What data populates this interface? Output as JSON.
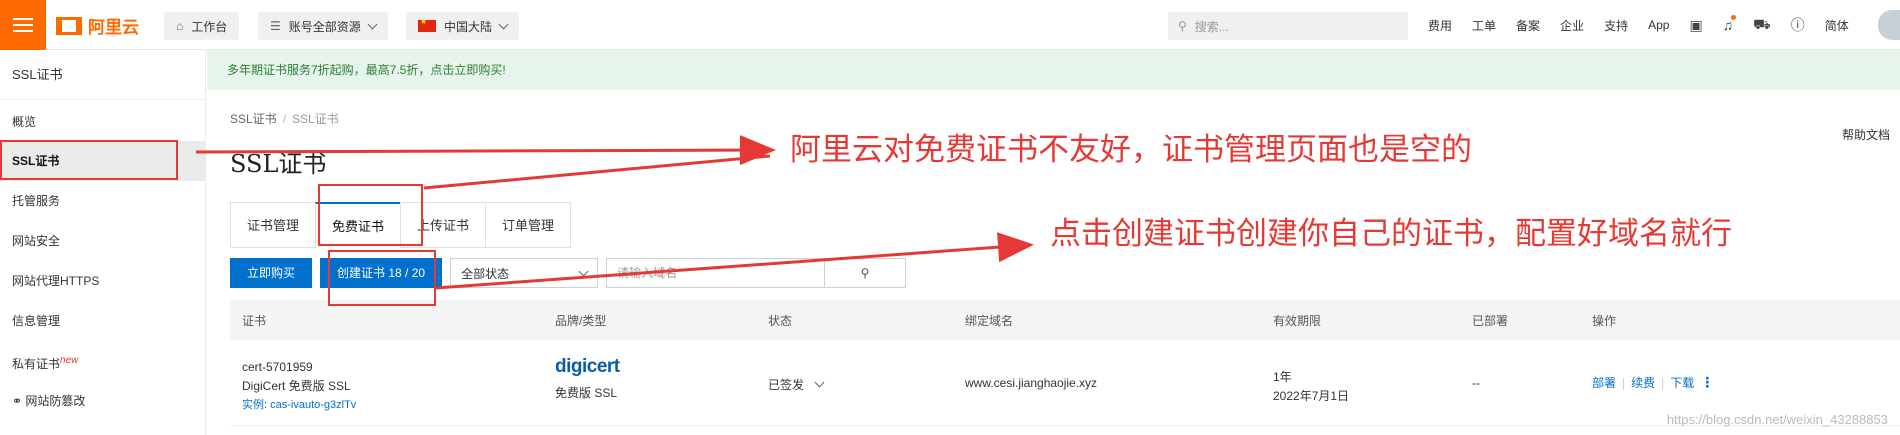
{
  "topbar": {
    "logo_text": "阿里云",
    "workbench": "工作台",
    "resources": "账号全部资源",
    "region": "中国大陆",
    "search_placeholder": "搜索...",
    "links": [
      "费用",
      "工单",
      "备案",
      "企业",
      "支持",
      "App"
    ],
    "lang": "简体",
    "accent_color": "#ff6a00"
  },
  "sidebar": {
    "title": "SSL证书",
    "items": [
      {
        "label": "概览"
      },
      {
        "label": "SSL证书"
      },
      {
        "label": "托管服务"
      },
      {
        "label": "网站安全"
      },
      {
        "label": "网站代理HTTPS"
      },
      {
        "label": "信息管理"
      },
      {
        "label": "私有证书",
        "badge": "new"
      },
      {
        "label": "网站防篡改"
      }
    ]
  },
  "banner": "多年期证书服务7折起购，最高7.5折，点击立即购买!",
  "breadcrumb": [
    "SSL证书",
    "SSL证书"
  ],
  "page_title": "SSL证书",
  "help_link": "帮助文档",
  "tabs": [
    "证书管理",
    "免费证书",
    "上传证书",
    "订单管理"
  ],
  "toolbar": {
    "buy": "立即购买",
    "create": "创建证书 18 / 20",
    "status_select": "全部状态",
    "domain_placeholder": "请输入域名"
  },
  "table": {
    "headers": [
      "证书",
      "品牌/类型",
      "状态",
      "绑定域名",
      "有效期限",
      "已部署",
      "操作"
    ],
    "rows": [
      {
        "cert_id": "cert-5701959",
        "cert_name": "DigiCert 免费版 SSL",
        "instance": "实例: cas-ivauto-g3zlTv",
        "brand_logo": "digicert",
        "brand_type": "免费版 SSL",
        "status": "已签发",
        "domain": "www.cesi.jianghaojie.xyz",
        "validity": "1年",
        "expire": "2022年7月1日",
        "deployed": "--",
        "actions": [
          "部署",
          "续费",
          "下载"
        ]
      }
    ]
  },
  "annotations": {
    "note1": "阿里云对免费证书不友好，证书管理页面也是空的",
    "note2": "点击创建证书创建你自己的证书，配置好域名就行",
    "color": "#e53935"
  },
  "watermark": "https://blog.csdn.net/weixin_43288853"
}
